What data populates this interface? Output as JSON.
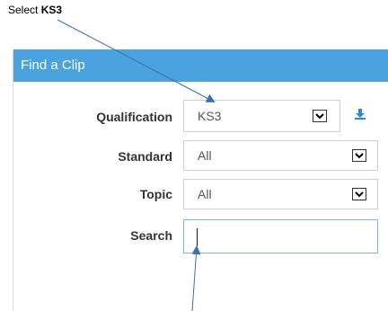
{
  "instruction": {
    "prefix": "Select ",
    "bold": "KS3"
  },
  "panel": {
    "title": "Find a Clip"
  },
  "form": {
    "qualification": {
      "label": "Qualification",
      "value": "KS3"
    },
    "standard": {
      "label": "Standard",
      "value": "All"
    },
    "topic": {
      "label": "Topic",
      "value": "All"
    },
    "search": {
      "label": "Search",
      "value": ""
    }
  },
  "colors": {
    "header": "#4aa3df",
    "arrow": "#3a6fb0",
    "download_icon": "#2a88d6"
  },
  "icons": {
    "dropdown": "chevron-down-icon",
    "download": "download-icon"
  }
}
